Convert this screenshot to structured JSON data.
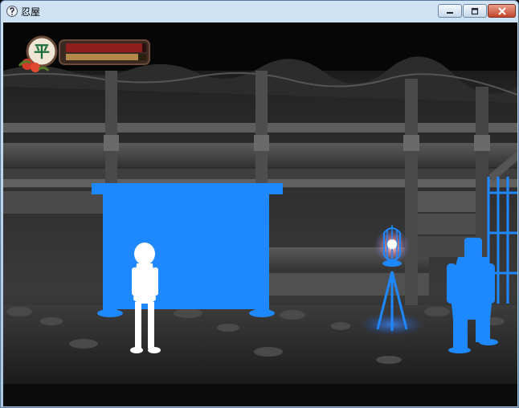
{
  "window": {
    "title": "忍屋",
    "icons": [
      "app-icon",
      "minimize-icon",
      "maximize-icon",
      "close-icon"
    ]
  },
  "hud": {
    "emblem_char": "平",
    "health_fraction": 0.95,
    "stamina_fraction": 0.9,
    "colors": {
      "health": "#8f1f1f",
      "stamina": "#b38a4a",
      "frame": "#6b4a3a"
    }
  },
  "scene": {
    "colors": {
      "highlight_blue": "#1e88ff",
      "player_white": "#ffffff",
      "wood_dark": "#2d2d2d",
      "wood_light": "#6e6e6e"
    }
  }
}
